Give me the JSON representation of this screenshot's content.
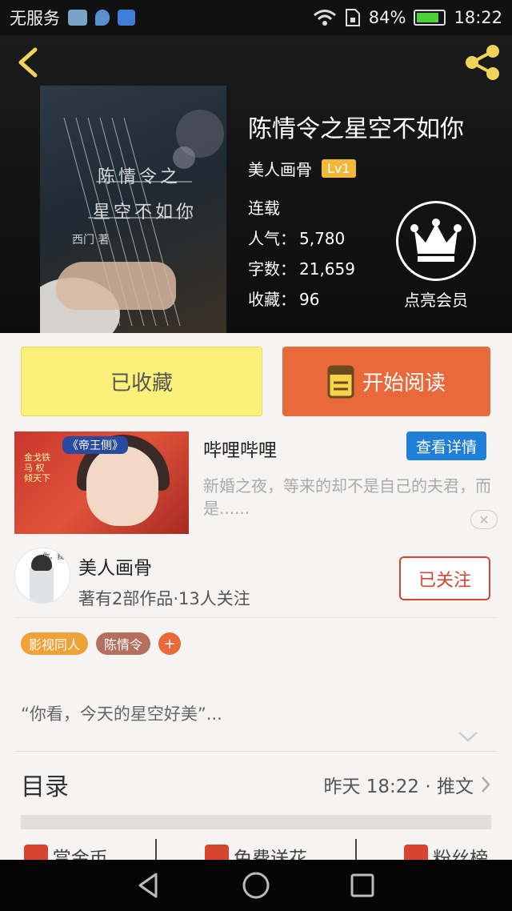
{
  "status_bar": {
    "carrier": "无服务",
    "battery": "84%",
    "battery_level": 0.84,
    "time": "18:22",
    "icons": [
      "cloud-icon",
      "location-icon",
      "qq-icon",
      "wifi-icon",
      "sim-icon",
      "battery-icon"
    ]
  },
  "book": {
    "title": "陈情令之星空不如你",
    "author": "美人画骨",
    "level": "Lv1",
    "status": "连载",
    "stats": [
      {
        "key": "人气：",
        "value": "5,780"
      },
      {
        "key": "字数：",
        "value": "21,659"
      },
      {
        "key": "收藏：",
        "value": "96"
      }
    ],
    "cover": {
      "line1": "陈情令之",
      "line2": "星空不如你",
      "line3": "西门 著"
    },
    "vip_label": "点亮会员"
  },
  "actions": {
    "collected": "已收藏",
    "read": "开始阅读"
  },
  "ad": {
    "image_tag": "《帝王侧》",
    "image_side": "金戈铁马 权倾天下",
    "title": "哔哩哔哩",
    "detail_button": "查看详情",
    "description": "新婚之夜，等来的却不是自己的夫君，而是......",
    "close": "✕"
  },
  "author_card": {
    "name": "美人画骨",
    "meta": "著有2部作品·13人关注",
    "follow": "已关注",
    "avatar_text": "你。我的"
  },
  "tags": [
    "影视同人",
    "陈情令"
  ],
  "tag_add": "+",
  "summary": "“你看，今天的星空好美”...",
  "toc": {
    "title": "目录",
    "meta": "昨天 18:22 · 推文"
  },
  "bottom_actions": [
    "赏金币",
    "免费送花",
    "粉丝榜"
  ],
  "colors": {
    "accent": "#e9693a",
    "collected_bg": "#fbf07a",
    "follow_red": "#d6452f",
    "detail_blue": "#1f7fd8",
    "level_gold": "#f0b93a"
  }
}
